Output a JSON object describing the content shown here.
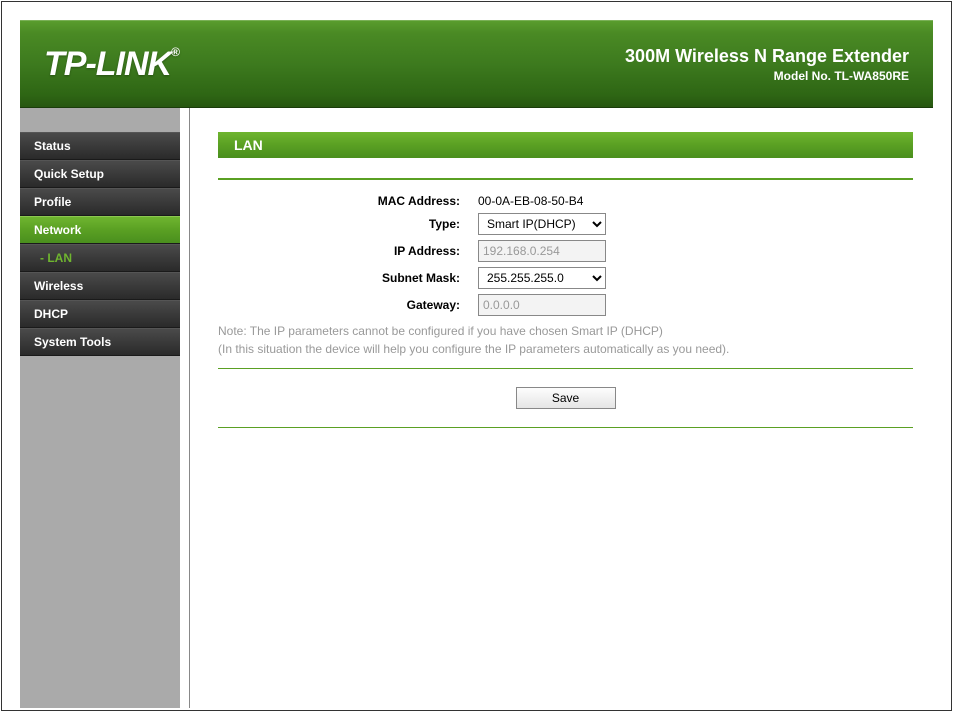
{
  "header": {
    "brand": "TP-LINK",
    "reg": "®",
    "product": "300M Wireless N Range Extender",
    "model_label": "Model No. TL-WA850RE"
  },
  "sidebar": {
    "items": [
      {
        "label": "Status",
        "active": false
      },
      {
        "label": "Quick Setup",
        "active": false
      },
      {
        "label": "Profile",
        "active": false
      },
      {
        "label": "Network",
        "active": true
      },
      {
        "label": "Wireless",
        "active": false
      },
      {
        "label": "DHCP",
        "active": false
      },
      {
        "label": "System Tools",
        "active": false
      }
    ],
    "sub_lan": "- LAN"
  },
  "page": {
    "title": "LAN",
    "mac_label": "MAC Address:",
    "mac_value": "00-0A-EB-08-50-B4",
    "type_label": "Type:",
    "type_value": "Smart IP(DHCP)",
    "ip_label": "IP Address:",
    "ip_value": "192.168.0.254",
    "mask_label": "Subnet Mask:",
    "mask_value": "255.255.255.0",
    "gateway_label": "Gateway:",
    "gateway_value": "0.0.0.0",
    "note_line1": "Note: The IP parameters cannot be configured if you have chosen Smart IP (DHCP)",
    "note_line2": "(In this situation the device will help you configure the IP parameters automatically as you need).",
    "save_label": "Save"
  }
}
